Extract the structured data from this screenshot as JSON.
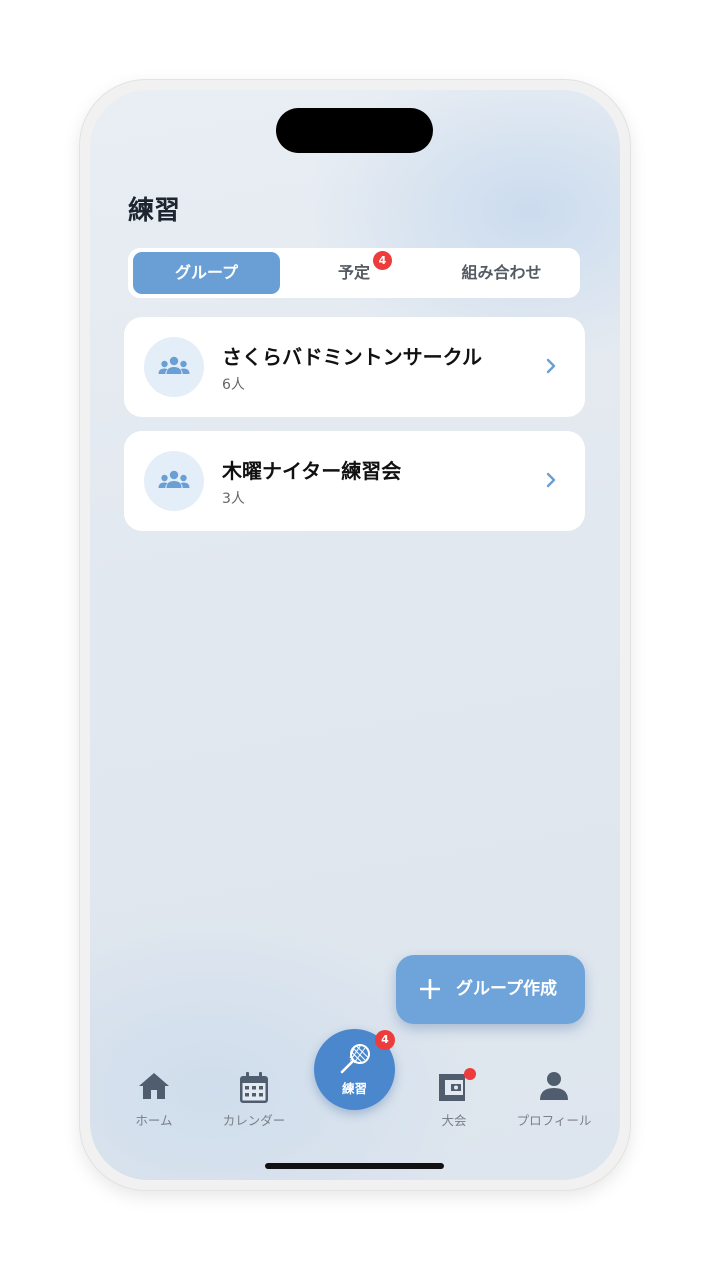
{
  "header": {
    "title": "練習"
  },
  "segments": {
    "items": [
      {
        "label": "グループ",
        "active": true
      },
      {
        "label": "予定",
        "badge": "4"
      },
      {
        "label": "組み合わせ"
      }
    ]
  },
  "groups": [
    {
      "name": "さくらバドミントンサークル",
      "count": "6人",
      "icon": "group-icon"
    },
    {
      "name": "木曜ナイター練習会",
      "count": "3人",
      "icon": "group-icon"
    }
  ],
  "fab": {
    "label": "グループ作成",
    "icon": "plus-icon"
  },
  "tabbar": {
    "home": "ホーム",
    "calendar": "カレンダー",
    "practice": "練習",
    "practice_badge": "4",
    "tournament": "大会",
    "profile": "プロフィール"
  },
  "colors": {
    "accent": "#6a9fd6",
    "center_button": "#4a87cc",
    "badge": "#ee3b3b"
  }
}
